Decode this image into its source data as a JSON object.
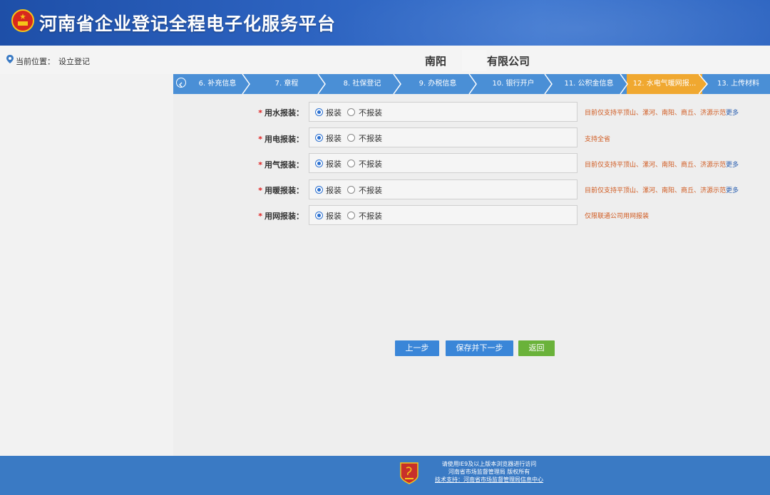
{
  "header": {
    "title": "河南省企业登记全程电子化服务平台",
    "emblem_icon": "national-emblem-icon"
  },
  "location": {
    "label": "当前位置：",
    "value": "设立登记"
  },
  "company": {
    "name_prefix": "南阳",
    "name_suffix": "有限公司"
  },
  "steps": [
    {
      "label": "6. 补充信息"
    },
    {
      "label": "7. 章程"
    },
    {
      "label": "8. 社保登记"
    },
    {
      "label": "9. 办税信息"
    },
    {
      "label": "10. 银行开户"
    },
    {
      "label": "11. 公积金信息"
    },
    {
      "label": "12. 水电气暖网报...",
      "active": true
    },
    {
      "label": "13. 上传材料"
    }
  ],
  "form": {
    "rows": [
      {
        "label": "用水报装：",
        "opt1": "报装",
        "opt2": "不报装",
        "note": "目前仅支持平顶山、漯河、南阳、商丘、济源示范",
        "more": "更多"
      },
      {
        "label": "用电报装：",
        "opt1": "报装",
        "opt2": "不报装",
        "note": "支持全省",
        "more": ""
      },
      {
        "label": "用气报装：",
        "opt1": "报装",
        "opt2": "不报装",
        "note": "目前仅支持平顶山、漯河、南阳、商丘、济源示范",
        "more": "更多"
      },
      {
        "label": "用暖报装：",
        "opt1": "报装",
        "opt2": "不报装",
        "note": "目前仅支持平顶山、漯河、南阳、商丘、济源示范",
        "more": "更多"
      },
      {
        "label": "用网报装：",
        "opt1": "报装",
        "opt2": "不报装",
        "note": "仅限联通公司用网报装",
        "more": ""
      }
    ]
  },
  "buttons": {
    "prev": "上一步",
    "save_next": "保存并下一步",
    "back": "返回"
  },
  "footer": {
    "line1": "请使用IE9及以上版本浏览器进行访问",
    "line2": "河南省市场监督管理局 版权所有",
    "line3": "技术支持：河南省市场监督管理局信息中心"
  },
  "colors": {
    "header": "#2d63c0",
    "step_bar": "#4a8fd6",
    "step_active": "#f0a830",
    "button_blue": "#3a86d8",
    "button_green": "#6ab23a",
    "note": "#d05a20"
  }
}
